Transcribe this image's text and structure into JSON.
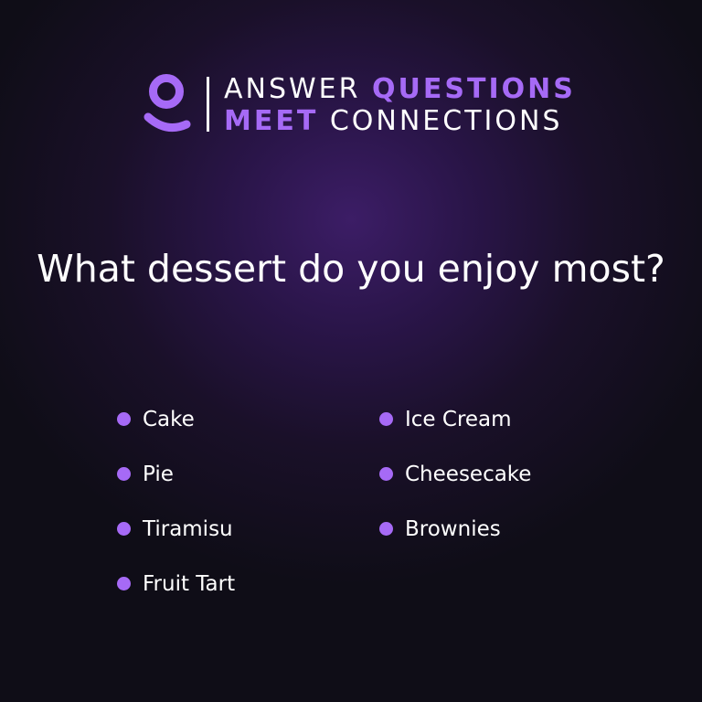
{
  "brand": {
    "line1": {
      "plain": "ANSWER",
      "accent": "QUESTIONS"
    },
    "line2": {
      "accent": "MEET",
      "plain": "CONNECTIONS"
    },
    "logo_icon": "user-icon",
    "accent_color": "#a66af6"
  },
  "question": "What dessert do you enjoy most?",
  "options": {
    "left": [
      "Cake",
      "Pie",
      "Tiramisu",
      "Fruit Tart"
    ],
    "right": [
      "Ice Cream",
      "Cheesecake",
      "Brownies"
    ]
  }
}
